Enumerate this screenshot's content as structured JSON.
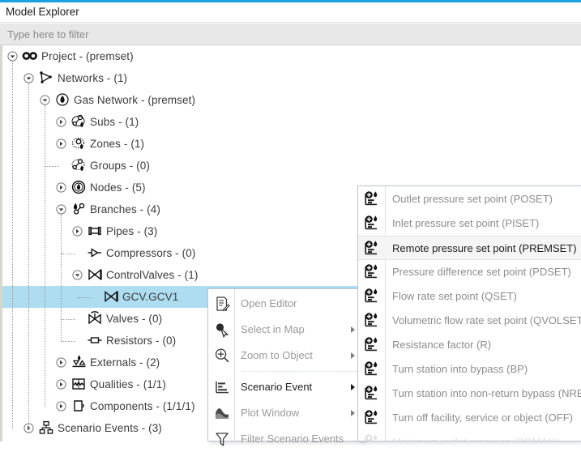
{
  "window": {
    "title": "Model Explorer",
    "accent_color": "#1BA1E2"
  },
  "filter": {
    "placeholder": "Type here to filter",
    "value": ""
  },
  "tree": {
    "selected_row_color": "#AEDCF0",
    "rows": [
      {
        "label": "Project - (premset)",
        "depth": 0,
        "icon": "infinity-icon",
        "twisty": "expanded",
        "selected": false
      },
      {
        "label": "Networks - (1)",
        "depth": 1,
        "icon": "network-graph-icon",
        "twisty": "expanded",
        "selected": false
      },
      {
        "label": "Gas Network - (premset)",
        "depth": 2,
        "icon": "flame-circle-icon",
        "twisty": "expanded",
        "selected": false
      },
      {
        "label": "Subs - (1)",
        "depth": 3,
        "icon": "subs-icon",
        "twisty": "collapsed",
        "selected": false
      },
      {
        "label": "Zones - (1)",
        "depth": 3,
        "icon": "zones-icon",
        "twisty": "collapsed",
        "selected": false
      },
      {
        "label": "Groups - (0)",
        "depth": 3,
        "icon": "groups-icon",
        "twisty": "none",
        "selected": false
      },
      {
        "label": "Nodes - (5)",
        "depth": 3,
        "icon": "node-flame-icon",
        "twisty": "collapsed",
        "selected": false
      },
      {
        "label": "Branches - (4)",
        "depth": 3,
        "icon": "branches-icon",
        "twisty": "expanded",
        "selected": false
      },
      {
        "label": "Pipes - (3)",
        "depth": 4,
        "icon": "pipe-icon",
        "twisty": "collapsed",
        "selected": false
      },
      {
        "label": "Compressors - (0)",
        "depth": 4,
        "icon": "compressor-icon",
        "twisty": "none",
        "selected": false
      },
      {
        "label": "ControlValves - (1)",
        "depth": 4,
        "icon": "controlvalve-icon",
        "twisty": "expanded",
        "selected": false
      },
      {
        "label": "GCV.GCV1",
        "depth": 5,
        "icon": "controlvalve-icon",
        "twisty": "none",
        "selected": true
      },
      {
        "label": "Valves - (0)",
        "depth": 4,
        "icon": "valve-icon",
        "twisty": "none",
        "selected": false
      },
      {
        "label": "Resistors - (0)",
        "depth": 4,
        "icon": "resistor-icon",
        "twisty": "none",
        "selected": false
      },
      {
        "label": "Externals - (2)",
        "depth": 3,
        "icon": "externals-icon",
        "twisty": "collapsed",
        "selected": false
      },
      {
        "label": "Qualities - (1/1)",
        "depth": 3,
        "icon": "qualities-icon",
        "twisty": "collapsed",
        "selected": false
      },
      {
        "label": "Components - (1/1/1)",
        "depth": 3,
        "icon": "components-icon",
        "twisty": "collapsed",
        "selected": false
      },
      {
        "label": "Scenario Events - (3)",
        "depth": 1,
        "icon": "scenario-tree-icon",
        "twisty": "collapsed",
        "selected": false
      }
    ]
  },
  "context_menu": {
    "items": [
      {
        "label": "Open Editor",
        "icon": "editor-icon",
        "enabled": false,
        "submenu": false,
        "separator_before": false
      },
      {
        "label": "Select in Map",
        "icon": "cursor-icon",
        "enabled": false,
        "submenu": true,
        "separator_before": false
      },
      {
        "label": "Zoom to Object",
        "icon": "magnifier-icon",
        "enabled": false,
        "submenu": true,
        "separator_before": false
      },
      {
        "label": "Scenario Event",
        "icon": "scenario-icon",
        "enabled": true,
        "submenu": true,
        "separator_before": true
      },
      {
        "label": "Plot Window",
        "icon": "plot-icon",
        "enabled": false,
        "submenu": true,
        "separator_before": false
      },
      {
        "label": "Filter Scenario Events",
        "icon": "funnel-icon",
        "enabled": false,
        "submenu": false,
        "separator_before": false
      }
    ]
  },
  "submenu": {
    "items": [
      {
        "label": "Outlet pressure set point (POSET)",
        "icon": "setpoint-icon",
        "highlight": false,
        "faded": false
      },
      {
        "label": "Inlet pressure set point (PISET)",
        "icon": "setpoint-icon",
        "highlight": false,
        "faded": false
      },
      {
        "label": "Remote pressure set point (PREMSET)",
        "icon": "setpoint-icon",
        "highlight": true,
        "faded": false
      },
      {
        "label": "Pressure difference set point (PDSET)",
        "icon": "setpoint-icon",
        "highlight": false,
        "faded": false
      },
      {
        "label": "Flow rate set point (QSET)",
        "icon": "setpoint-icon",
        "highlight": false,
        "faded": false
      },
      {
        "label": "Volumetric flow rate set point (QVOLSET)",
        "icon": "setpoint-icon",
        "highlight": false,
        "faded": false
      },
      {
        "label": "Resistance factor (R)",
        "icon": "setpoint-icon",
        "highlight": false,
        "faded": false
      },
      {
        "label": "Turn station into bypass (BP)",
        "icon": "setpoint-icon",
        "highlight": false,
        "faded": false
      },
      {
        "label": "Turn station into non-return bypass (NRBP)",
        "icon": "setpoint-icon",
        "highlight": false,
        "faded": false
      },
      {
        "label": "Turn off facility, service or object (OFF)",
        "icon": "setpoint-icon",
        "highlight": false,
        "faded": false
      },
      {
        "label": "Maximum outlet pressure (POMAX)",
        "icon": "setpoint-icon",
        "highlight": false,
        "faded": true
      }
    ]
  }
}
